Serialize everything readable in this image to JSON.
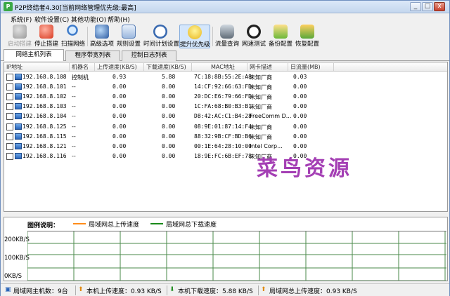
{
  "window": {
    "title": "P2P终结者4.30[当前网络管理优先级:最高]",
    "min": "_",
    "max": "□",
    "close": "x"
  },
  "menu": [
    "系统(F)",
    "软件设置(C)",
    "其他功能(O)",
    "帮助(H)"
  ],
  "toolbar": [
    {
      "label": "启动搭建",
      "icon": "start-icon",
      "disabled": true
    },
    {
      "label": "停止搭建",
      "icon": "stop-icon"
    },
    {
      "label": "扫描网络",
      "icon": "scan-icon"
    },
    {
      "label": "高级选项",
      "icon": "advanced-icon"
    },
    {
      "label": "规则设置",
      "icon": "rules-icon"
    },
    {
      "label": "时间计划设置",
      "icon": "schedule-icon"
    },
    {
      "label": "提升优先级",
      "icon": "priority-icon",
      "active": true
    },
    {
      "label": "流量查询",
      "icon": "traffic-query-icon"
    },
    {
      "label": "网速测试",
      "icon": "speed-test-icon"
    },
    {
      "label": "备份配置",
      "icon": "backup-icon"
    },
    {
      "label": "恢复配置",
      "icon": "restore-icon"
    }
  ],
  "tabs": [
    "网络主机列表",
    "程序带宽列表",
    "控制日志列表"
  ],
  "columns": [
    "IP地址",
    "机器名",
    "上传速度(KB/S)",
    "下载速度(KB/S)",
    "MAC地址",
    "网卡描述",
    "日流量(MB)"
  ],
  "rows": [
    {
      "ip": "192.168.8.108",
      "name": "控制机",
      "up": "0.93",
      "down": "5.88",
      "mac": "7C:18:8B:55:2E:A8",
      "nic": "未知厂商",
      "flow": "0.03"
    },
    {
      "ip": "192.168.8.101",
      "name": "--",
      "up": "0.00",
      "down": "0.00",
      "mac": "14:CF:92:66:63:FD",
      "nic": "未知厂商",
      "flow": "0.00"
    },
    {
      "ip": "192.168.8.102",
      "name": "--",
      "up": "0.00",
      "down": "0.00",
      "mac": "20:DC:E6:79:66:FD",
      "nic": "未知厂商",
      "flow": "0.00"
    },
    {
      "ip": "192.168.8.103",
      "name": "--",
      "up": "0.00",
      "down": "0.00",
      "mac": "1C:FA:68:B0:B3:B1",
      "nic": "未知厂商",
      "flow": "0.00"
    },
    {
      "ip": "192.168.8.104",
      "name": "--",
      "up": "0.00",
      "down": "0.00",
      "mac": "D8:42:AC:C1:B4:28",
      "nic": "FreeComm D...",
      "flow": "0.00"
    },
    {
      "ip": "192.168.8.125",
      "name": "--",
      "up": "0.00",
      "down": "0.00",
      "mac": "08:9E:01:87:14:F4",
      "nic": "未知厂商",
      "flow": "0.00"
    },
    {
      "ip": "192.168.8.115",
      "name": "--",
      "up": "0.00",
      "down": "0.00",
      "mac": "88:32:9B:CF:BD:B6",
      "nic": "未知厂商",
      "flow": "0.00"
    },
    {
      "ip": "192.168.8.121",
      "name": "--",
      "up": "0.00",
      "down": "0.00",
      "mac": "00:1E:64:28:10:00",
      "nic": "Intel Corp...",
      "flow": "0.00"
    },
    {
      "ip": "192.168.8.116",
      "name": "--",
      "up": "0.00",
      "down": "0.00",
      "mac": "18:9E:FC:6B:EF:78",
      "nic": "未知厂商",
      "flow": "0.00"
    }
  ],
  "watermark": "菜鸟资源",
  "legend": {
    "title": "图例说明：",
    "up": "局域网总上传速度",
    "down": "局域网总下载速度",
    "up_color": "#ff8c1a",
    "down_color": "#1a8a1a"
  },
  "graph": {
    "y_labels": [
      "200KB/S",
      "100KB/S",
      "0KB/S"
    ]
  },
  "status": {
    "hosts": "局域网主机数：9台",
    "local_up": "本机上传速度：0.93 KB/S",
    "local_down": "本机下载速度：5.88 KB/S",
    "lan_up": "局域网总上传速度：0.93 KB/S"
  }
}
